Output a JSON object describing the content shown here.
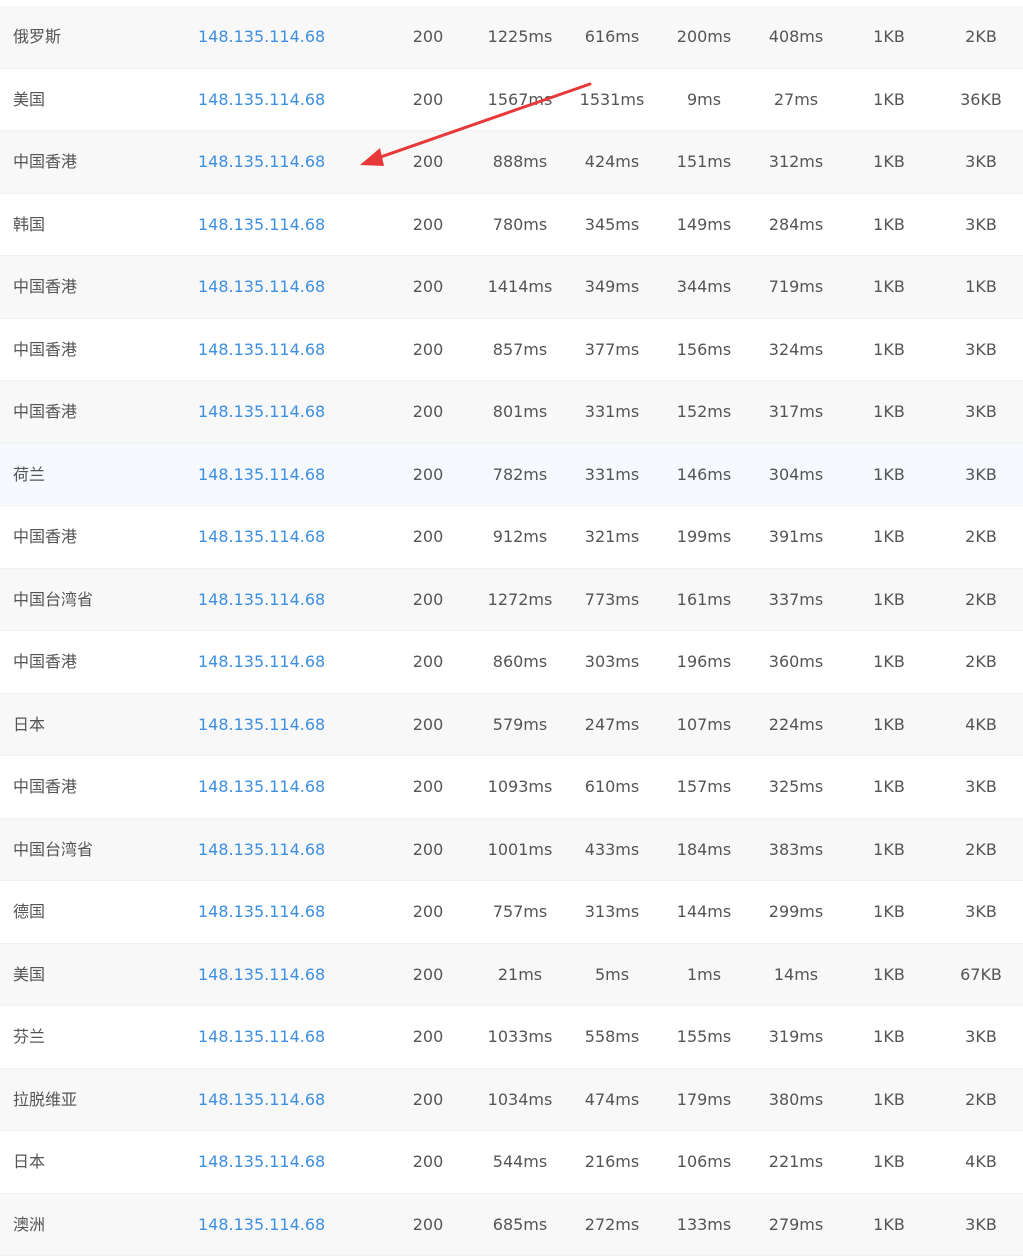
{
  "table": {
    "rows": [
      {
        "location": "俄罗斯",
        "ip": "148.135.114.68",
        "status": "200",
        "total": "1225ms",
        "resolve": "616ms",
        "connect": "200ms",
        "download": "408ms",
        "head": "1KB",
        "size": "2KB"
      },
      {
        "location": "美国",
        "ip": "148.135.114.68",
        "status": "200",
        "total": "1567ms",
        "resolve": "1531ms",
        "connect": "9ms",
        "download": "27ms",
        "head": "1KB",
        "size": "36KB"
      },
      {
        "location": "中国香港",
        "ip": "148.135.114.68",
        "status": "200",
        "total": "888ms",
        "resolve": "424ms",
        "connect": "151ms",
        "download": "312ms",
        "head": "1KB",
        "size": "3KB"
      },
      {
        "location": "韩国",
        "ip": "148.135.114.68",
        "status": "200",
        "total": "780ms",
        "resolve": "345ms",
        "connect": "149ms",
        "download": "284ms",
        "head": "1KB",
        "size": "3KB"
      },
      {
        "location": "中国香港",
        "ip": "148.135.114.68",
        "status": "200",
        "total": "1414ms",
        "resolve": "349ms",
        "connect": "344ms",
        "download": "719ms",
        "head": "1KB",
        "size": "1KB"
      },
      {
        "location": "中国香港",
        "ip": "148.135.114.68",
        "status": "200",
        "total": "857ms",
        "resolve": "377ms",
        "connect": "156ms",
        "download": "324ms",
        "head": "1KB",
        "size": "3KB"
      },
      {
        "location": "中国香港",
        "ip": "148.135.114.68",
        "status": "200",
        "total": "801ms",
        "resolve": "331ms",
        "connect": "152ms",
        "download": "317ms",
        "head": "1KB",
        "size": "3KB"
      },
      {
        "location": "荷兰",
        "ip": "148.135.114.68",
        "status": "200",
        "total": "782ms",
        "resolve": "331ms",
        "connect": "146ms",
        "download": "304ms",
        "head": "1KB",
        "size": "3KB"
      },
      {
        "location": "中国香港",
        "ip": "148.135.114.68",
        "status": "200",
        "total": "912ms",
        "resolve": "321ms",
        "connect": "199ms",
        "download": "391ms",
        "head": "1KB",
        "size": "2KB"
      },
      {
        "location": "中国台湾省",
        "ip": "148.135.114.68",
        "status": "200",
        "total": "1272ms",
        "resolve": "773ms",
        "connect": "161ms",
        "download": "337ms",
        "head": "1KB",
        "size": "2KB"
      },
      {
        "location": "中国香港",
        "ip": "148.135.114.68",
        "status": "200",
        "total": "860ms",
        "resolve": "303ms",
        "connect": "196ms",
        "download": "360ms",
        "head": "1KB",
        "size": "2KB"
      },
      {
        "location": "日本",
        "ip": "148.135.114.68",
        "status": "200",
        "total": "579ms",
        "resolve": "247ms",
        "connect": "107ms",
        "download": "224ms",
        "head": "1KB",
        "size": "4KB"
      },
      {
        "location": "中国香港",
        "ip": "148.135.114.68",
        "status": "200",
        "total": "1093ms",
        "resolve": "610ms",
        "connect": "157ms",
        "download": "325ms",
        "head": "1KB",
        "size": "3KB"
      },
      {
        "location": "中国台湾省",
        "ip": "148.135.114.68",
        "status": "200",
        "total": "1001ms",
        "resolve": "433ms",
        "connect": "184ms",
        "download": "383ms",
        "head": "1KB",
        "size": "2KB"
      },
      {
        "location": "德国",
        "ip": "148.135.114.68",
        "status": "200",
        "total": "757ms",
        "resolve": "313ms",
        "connect": "144ms",
        "download": "299ms",
        "head": "1KB",
        "size": "3KB"
      },
      {
        "location": "美国",
        "ip": "148.135.114.68",
        "status": "200",
        "total": "21ms",
        "resolve": "5ms",
        "connect": "1ms",
        "download": "14ms",
        "head": "1KB",
        "size": "67KB"
      },
      {
        "location": "芬兰",
        "ip": "148.135.114.68",
        "status": "200",
        "total": "1033ms",
        "resolve": "558ms",
        "connect": "155ms",
        "download": "319ms",
        "head": "1KB",
        "size": "3KB"
      },
      {
        "location": "拉脱维亚",
        "ip": "148.135.114.68",
        "status": "200",
        "total": "1034ms",
        "resolve": "474ms",
        "connect": "179ms",
        "download": "380ms",
        "head": "1KB",
        "size": "2KB"
      },
      {
        "location": "日本",
        "ip": "148.135.114.68",
        "status": "200",
        "total": "544ms",
        "resolve": "216ms",
        "connect": "106ms",
        "download": "221ms",
        "head": "1KB",
        "size": "4KB"
      },
      {
        "location": "澳洲",
        "ip": "148.135.114.68",
        "status": "200",
        "total": "685ms",
        "resolve": "272ms",
        "connect": "133ms",
        "download": "279ms",
        "head": "1KB",
        "size": "3KB"
      }
    ]
  },
  "colors": {
    "link": "#3d8fe0",
    "text": "#555555",
    "row_alt": "#f8f8f8",
    "annotation_arrow": "#e8393a"
  }
}
